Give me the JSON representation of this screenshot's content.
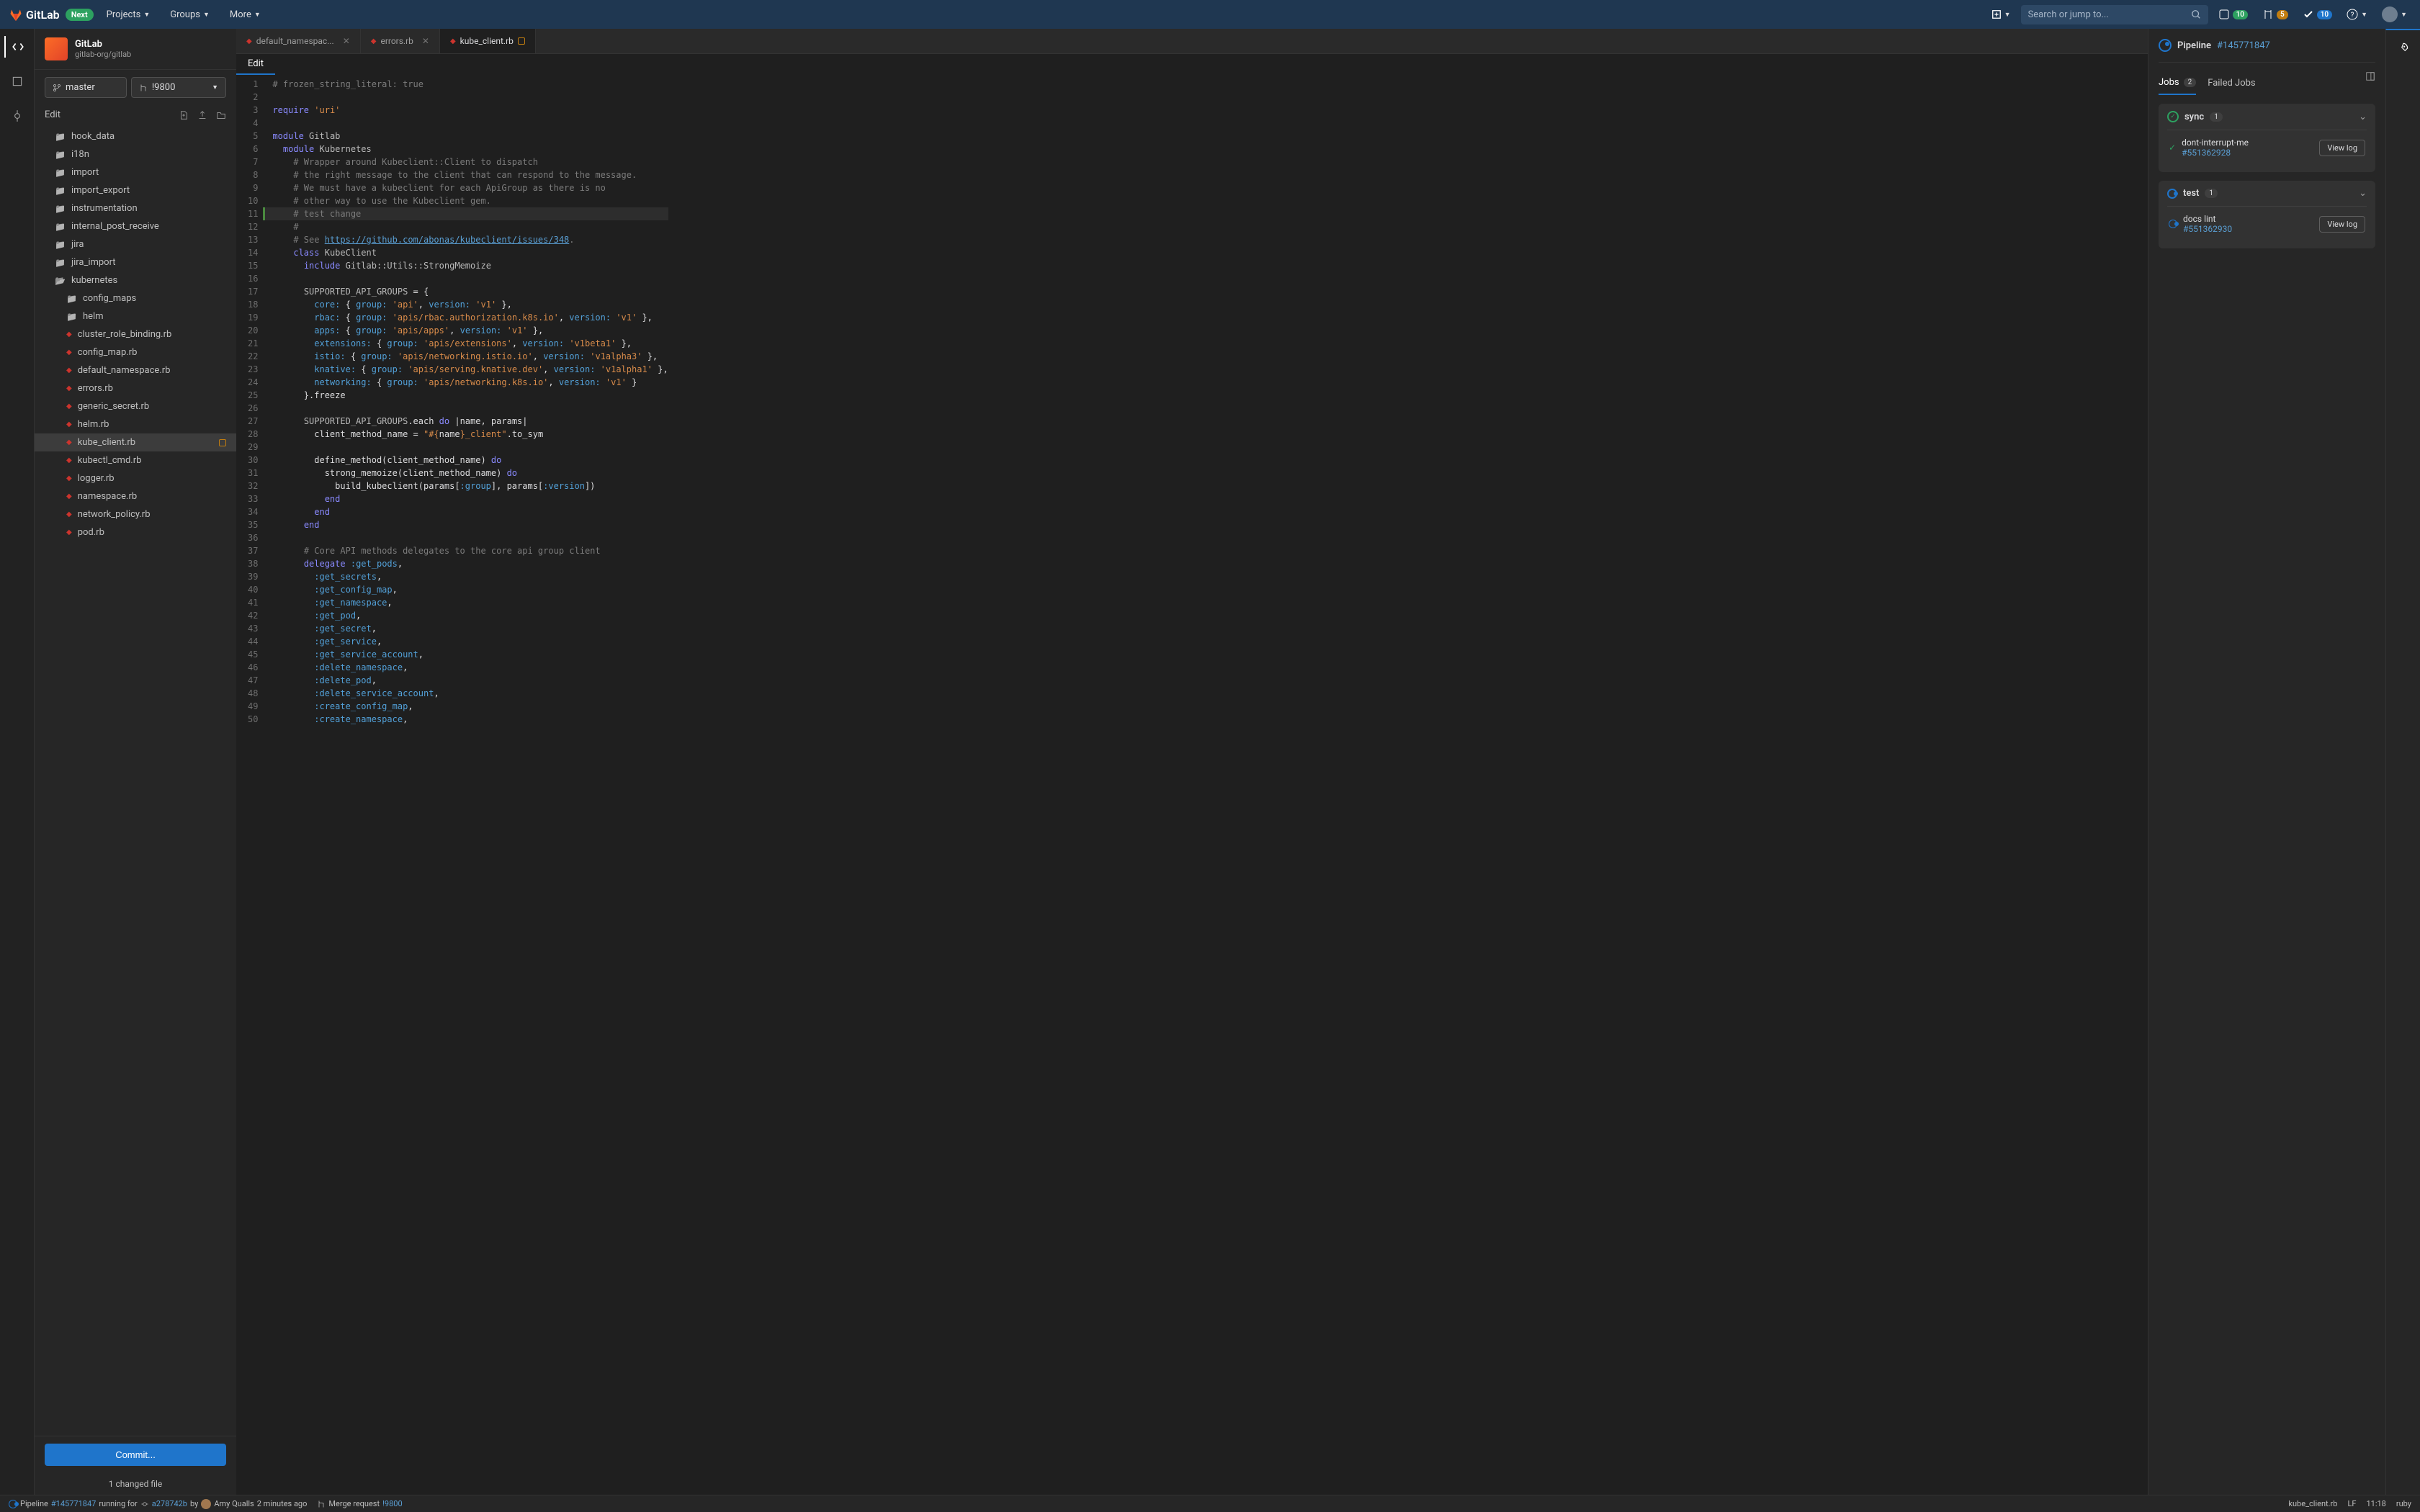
{
  "topbar": {
    "brand": "GitLab",
    "next_badge": "Next",
    "nav": {
      "projects": "Projects",
      "groups": "Groups",
      "more": "More"
    },
    "search_placeholder": "Search or jump to...",
    "badge_issues": "10",
    "badge_mrs": "5",
    "badge_todos": "10"
  },
  "project": {
    "name": "GitLab",
    "path": "gitlab-org/gitlab",
    "branch": "master",
    "mr": "!9800"
  },
  "sidebar": {
    "edit_label": "Edit",
    "commit_btn": "Commit...",
    "changed": "1 changed file",
    "tree": [
      {
        "name": "hook_data",
        "type": "folder",
        "indent": 0
      },
      {
        "name": "i18n",
        "type": "folder",
        "indent": 0
      },
      {
        "name": "import",
        "type": "folder",
        "indent": 0
      },
      {
        "name": "import_export",
        "type": "folder",
        "indent": 0
      },
      {
        "name": "instrumentation",
        "type": "folder",
        "indent": 0
      },
      {
        "name": "internal_post_receive",
        "type": "folder",
        "indent": 0
      },
      {
        "name": "jira",
        "type": "folder",
        "indent": 0
      },
      {
        "name": "jira_import",
        "type": "folder",
        "indent": 0
      },
      {
        "name": "kubernetes",
        "type": "folder-open",
        "indent": 0
      },
      {
        "name": "config_maps",
        "type": "folder",
        "indent": 1
      },
      {
        "name": "helm",
        "type": "folder",
        "indent": 1
      },
      {
        "name": "cluster_role_binding.rb",
        "type": "ruby",
        "indent": 1
      },
      {
        "name": "config_map.rb",
        "type": "ruby",
        "indent": 1
      },
      {
        "name": "default_namespace.rb",
        "type": "ruby",
        "indent": 1
      },
      {
        "name": "errors.rb",
        "type": "ruby",
        "indent": 1
      },
      {
        "name": "generic_secret.rb",
        "type": "ruby",
        "indent": 1
      },
      {
        "name": "helm.rb",
        "type": "ruby",
        "indent": 1
      },
      {
        "name": "kube_client.rb",
        "type": "ruby",
        "indent": 1,
        "active": true,
        "modified": true
      },
      {
        "name": "kubectl_cmd.rb",
        "type": "ruby",
        "indent": 1
      },
      {
        "name": "logger.rb",
        "type": "ruby",
        "indent": 1
      },
      {
        "name": "namespace.rb",
        "type": "ruby",
        "indent": 1
      },
      {
        "name": "network_policy.rb",
        "type": "ruby",
        "indent": 1
      },
      {
        "name": "pod.rb",
        "type": "ruby",
        "indent": 1
      }
    ]
  },
  "tabs": [
    {
      "name": "default_namespac...",
      "icon": "ruby"
    },
    {
      "name": "errors.rb",
      "icon": "ruby"
    },
    {
      "name": "kube_client.rb",
      "icon": "ruby",
      "active": true,
      "modified": true
    }
  ],
  "edit_mode": "Edit",
  "code_lines": 50,
  "pipeline": {
    "title": "Pipeline",
    "id": "#145771847",
    "tabs": {
      "jobs": "Jobs",
      "jobs_count": "2",
      "failed": "Failed Jobs"
    },
    "stages": [
      {
        "name": "sync",
        "count": "1",
        "status": "success",
        "jobs": [
          {
            "name": "dont-interrupt-me",
            "id": "#551362928",
            "status": "success"
          }
        ],
        "view_log": "View log"
      },
      {
        "name": "test",
        "count": "1",
        "status": "running",
        "jobs": [
          {
            "name": "docs lint",
            "id": "#551362930",
            "status": "running"
          }
        ],
        "view_log": "View log"
      }
    ]
  },
  "statusbar": {
    "pipeline_label": "Pipeline",
    "pipeline_id": "#145771847",
    "running_for": "running for",
    "commit": "a278742b",
    "by": "by",
    "author": "Amy Qualls",
    "time_ago": "2 minutes ago",
    "mr_label": "Merge request",
    "mr_id": "!9800",
    "filename": "kube_client.rb",
    "line_ending": "LF",
    "cursor": "11:18",
    "lang": "ruby"
  }
}
